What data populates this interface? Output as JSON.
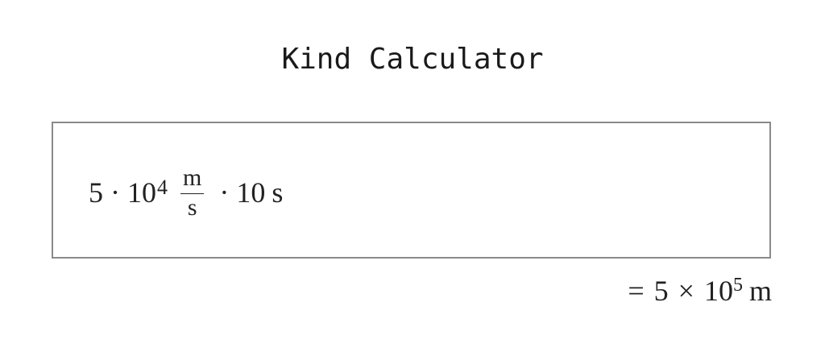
{
  "app": {
    "title": "Kind Calculator"
  },
  "input": {
    "coefficient": "5",
    "dot1": "·",
    "base": "10",
    "exponent": "4",
    "unit_numerator": "m",
    "unit_denominator": "s",
    "dot2": "·",
    "multiplier": "10",
    "multiplier_unit": "s"
  },
  "result": {
    "equals": "=",
    "coefficient": "5",
    "times": "×",
    "base": "10",
    "exponent": "5",
    "unit": "m"
  }
}
